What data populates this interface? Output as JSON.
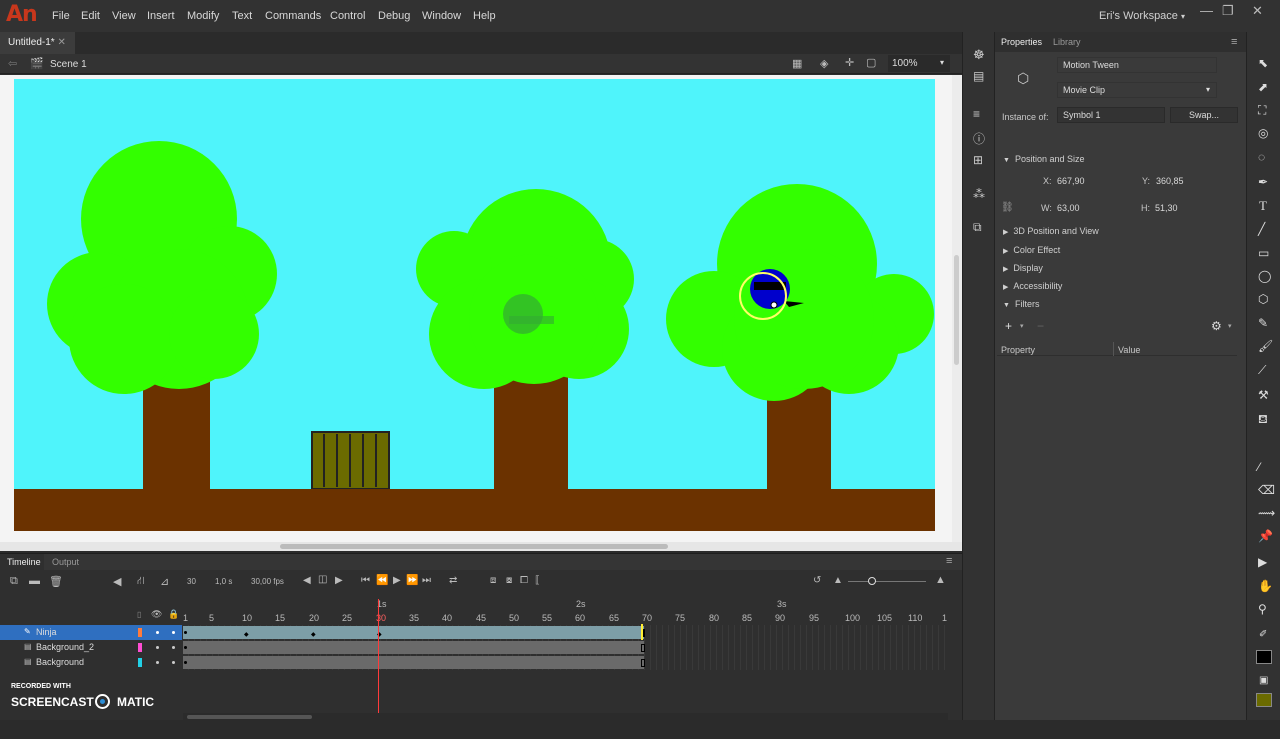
{
  "app": {
    "logo": "An",
    "workspace": "Eri's Workspace"
  },
  "menu": [
    "File",
    "Edit",
    "View",
    "Insert",
    "Modify",
    "Text",
    "Commands",
    "Control",
    "Debug",
    "Window",
    "Help"
  ],
  "document": {
    "tab": "Untitled-1*",
    "scene": "Scene 1",
    "zoom": "100%"
  },
  "properties": {
    "tabs": [
      "Properties",
      "Library"
    ],
    "type_label": "Motion Tween",
    "instance_behavior": "Movie Clip",
    "instance_of_label": "Instance of:",
    "instance_of": "Symbol 1",
    "swap": "Swap...",
    "sections": {
      "position_size": "Position and Size",
      "pos3d": "3D Position and View",
      "color_effect": "Color Effect",
      "display": "Display",
      "accessibility": "Accessibility",
      "filters": "Filters"
    },
    "x_label": "X:",
    "x": "667,90",
    "y_label": "Y:",
    "y": "360,85",
    "w_label": "W:",
    "w": "63,00",
    "h_label": "H:",
    "h": "51,30",
    "filter_col_property": "Property",
    "filter_col_value": "Value"
  },
  "timeline": {
    "tabs": [
      "Timeline",
      "Output"
    ],
    "current_frame": "30",
    "time": "1,0 s",
    "fps": "30,00 fps",
    "ruler_numbers": [
      "1",
      "5",
      "10",
      "15",
      "20",
      "25",
      "30",
      "35",
      "40",
      "45",
      "50",
      "55",
      "60",
      "65",
      "70",
      "75",
      "80",
      "85",
      "90",
      "95",
      "100",
      "105",
      "110",
      "1"
    ],
    "seconds": [
      "1s",
      "2s",
      "3s"
    ],
    "layers": [
      {
        "name": "Ninja",
        "color": "#ff7b3b"
      },
      {
        "name": "Background_2",
        "color": "#ff4dd2"
      },
      {
        "name": "Background",
        "color": "#22d0e6"
      }
    ]
  },
  "watermark": {
    "line1": "RECORDED WITH",
    "line2a": "SCREENCAST",
    "line2b": "MATIC"
  },
  "colors": {
    "sky": "#4ff4fb",
    "foliage": "#33ff00",
    "trunk": "#6b3200",
    "ground": "#6b3200",
    "crate": "#6b6b00",
    "ninja": "#0000cc",
    "selection": "#2f6fc0"
  }
}
